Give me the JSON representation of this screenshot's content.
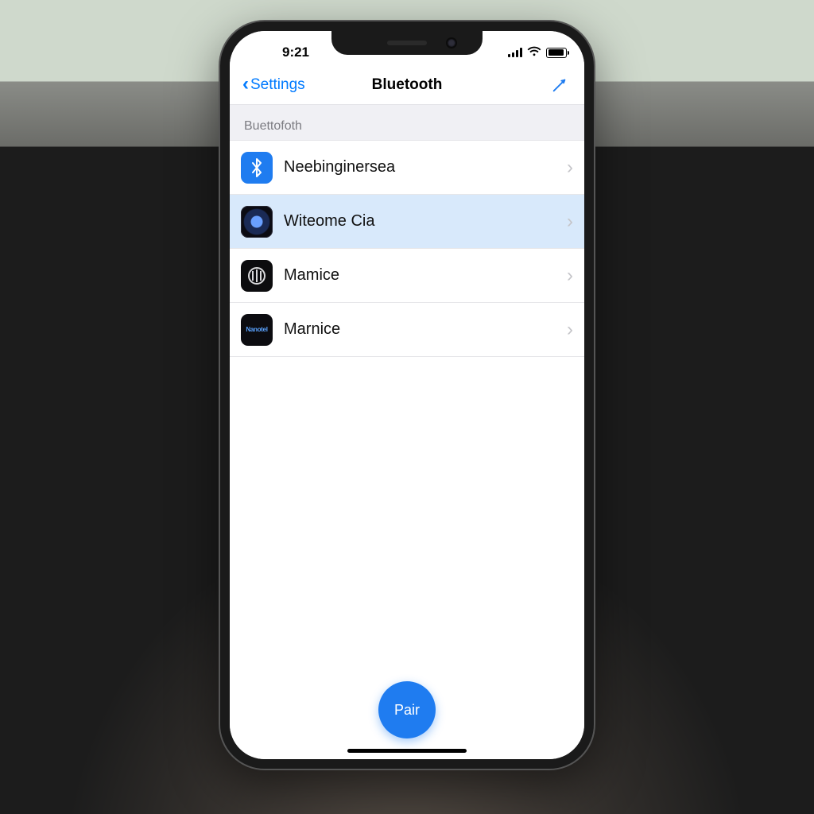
{
  "status": {
    "time": "9:21"
  },
  "nav": {
    "back_label": "Settings",
    "title": "Bluetooth"
  },
  "section_header": "Buettofoth",
  "devices": [
    {
      "label": "Neebinginersea",
      "icon": "bluetooth",
      "selected": false
    },
    {
      "label": "Witeome Cia",
      "icon": "camera",
      "selected": true
    },
    {
      "label": "Mamice",
      "icon": "sound",
      "selected": false
    },
    {
      "label": "Marnice",
      "icon": "label",
      "selected": false
    }
  ],
  "pair_button": "Pair",
  "colors": {
    "accent": "#007aff",
    "blue": "#1f7cf0",
    "selected_row": "#d8e9fb",
    "section_bg": "#f0f0f4"
  }
}
